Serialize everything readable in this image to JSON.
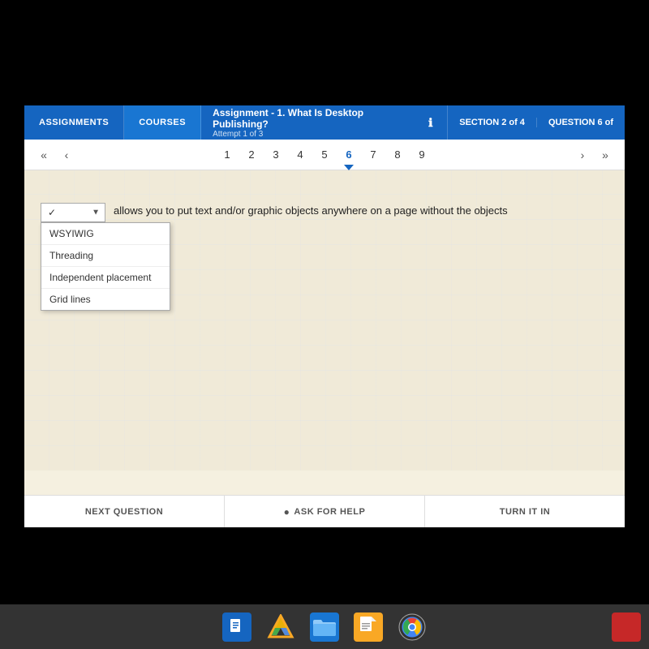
{
  "nav": {
    "assignments_label": "ASSIGNMENTS",
    "courses_label": "COURSES",
    "assignment_title": "Assignment - 1. What Is Desktop Publishing?",
    "assignment_subtitle": "Attempt 1 of 3",
    "info_icon": "ℹ",
    "section_label": "SECTION 2 of 4",
    "question_label": "QUESTION 6 of"
  },
  "pagination": {
    "first_label": "«",
    "prev_label": "‹",
    "next_label": "›",
    "last_label": "»",
    "pages": [
      "1",
      "2",
      "3",
      "4",
      "5",
      "6",
      "7",
      "8",
      "9"
    ],
    "current_page": "6"
  },
  "question": {
    "dropdown_selected": "✓",
    "text": "allows you to put text and/or graphic objects anywhere on a page without the objects nearby",
    "options": [
      "WSYIWIG",
      "Threading",
      "Independent placement",
      "Grid lines"
    ]
  },
  "footer": {
    "next_question_label": "NEXT QUESTION",
    "ask_for_help_label": "ASK FOR HELP",
    "ask_for_help_icon": "●",
    "turn_it_in_label": "TURN IT IN"
  },
  "taskbar": {
    "files_icon": "📄",
    "drive_icon": "▲",
    "folder_icon": "📁",
    "docs_icon": "📄",
    "chrome_icon": "◉"
  }
}
